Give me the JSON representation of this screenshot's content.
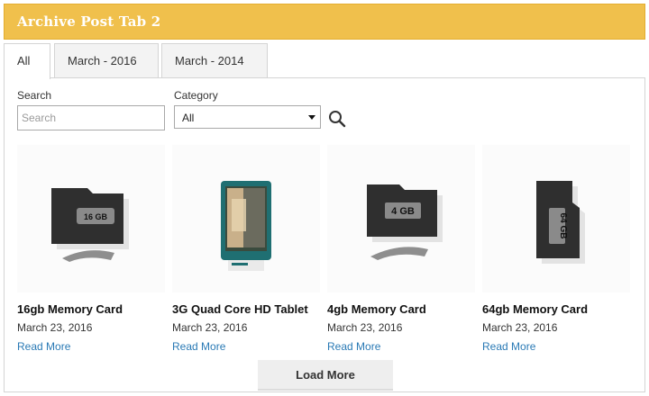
{
  "widget": {
    "title": "Archive Post Tab 2"
  },
  "tabs": [
    {
      "label": "All",
      "active": true
    },
    {
      "label": "March - 2016",
      "active": false
    },
    {
      "label": "March - 2014",
      "active": false
    }
  ],
  "filters": {
    "search_label": "Search",
    "search_placeholder": "Search",
    "search_value": "",
    "category_label": "Category",
    "category_selected": "All",
    "search_button_icon": "magnifier-icon"
  },
  "posts": [
    {
      "title": "16gb Memory Card",
      "date": "March 23, 2016",
      "link": "Read More",
      "image_icon": "memory-card-icon",
      "card_text": "16 GB"
    },
    {
      "title": "3G Quad Core HD Tablet",
      "date": "March 23, 2016",
      "link": "Read More",
      "image_icon": "tablet-icon"
    },
    {
      "title": "4gb Memory Card",
      "date": "March 23, 2016",
      "link": "Read More",
      "image_icon": "memory-card-icon",
      "card_text": "4 GB"
    },
    {
      "title": "64gb Memory Card",
      "date": "March 23, 2016",
      "link": "Read More",
      "image_icon": "memory-card-icon",
      "card_text": "64 GB"
    }
  ],
  "load_more_label": "Load More",
  "colors": {
    "title_bar": "#f0c04c",
    "link": "#2a7ab5",
    "tab_inactive": "#f3f3f3",
    "button_bg": "#eeeeee"
  }
}
